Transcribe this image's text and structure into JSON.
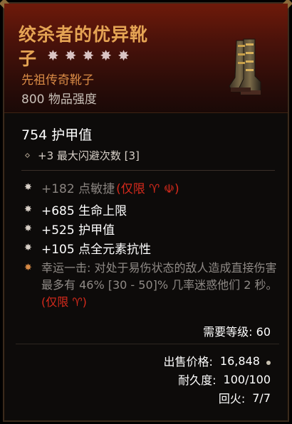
{
  "item": {
    "name_line1": "绞杀者的优异靴",
    "name_line2": "子",
    "stars": [
      "✸",
      "✸",
      "✸",
      "✸",
      "✸"
    ],
    "type": "先祖传奇靴子",
    "item_power": "800 物品强度",
    "armor": "754 护甲值",
    "implicit": "+3 最大闪避次数 [3]",
    "affixes": [
      {
        "text": "+182 点敏捷",
        "req": "(仅限 ♈ ☫)",
        "faded": true
      },
      {
        "text": "+685 生命上限",
        "req": "",
        "faded": false
      },
      {
        "text": "+525 护甲值",
        "req": "",
        "faded": false
      },
      {
        "text": "+105 点全元素抗性",
        "req": "",
        "faded": false
      }
    ],
    "legendary_text": "幸运一击: 对处于易伤状态的敌人造成直接伤害最多有 46% [30 - 50]% 几率迷惑他们 2 秒。",
    "legendary_req": "(仅限 ♈)",
    "level_req": "需要等级: 60",
    "sell_label": "出售价格:",
    "sell_value": "16,848",
    "durability_label": "耐久度:",
    "durability_value": "100/100",
    "temper_label": "回火:",
    "temper_value": "7/7"
  },
  "colors": {
    "legendary_name": "#e5a454",
    "legendary_type": "#d88a45",
    "requirement_red": "#d62a1c"
  }
}
